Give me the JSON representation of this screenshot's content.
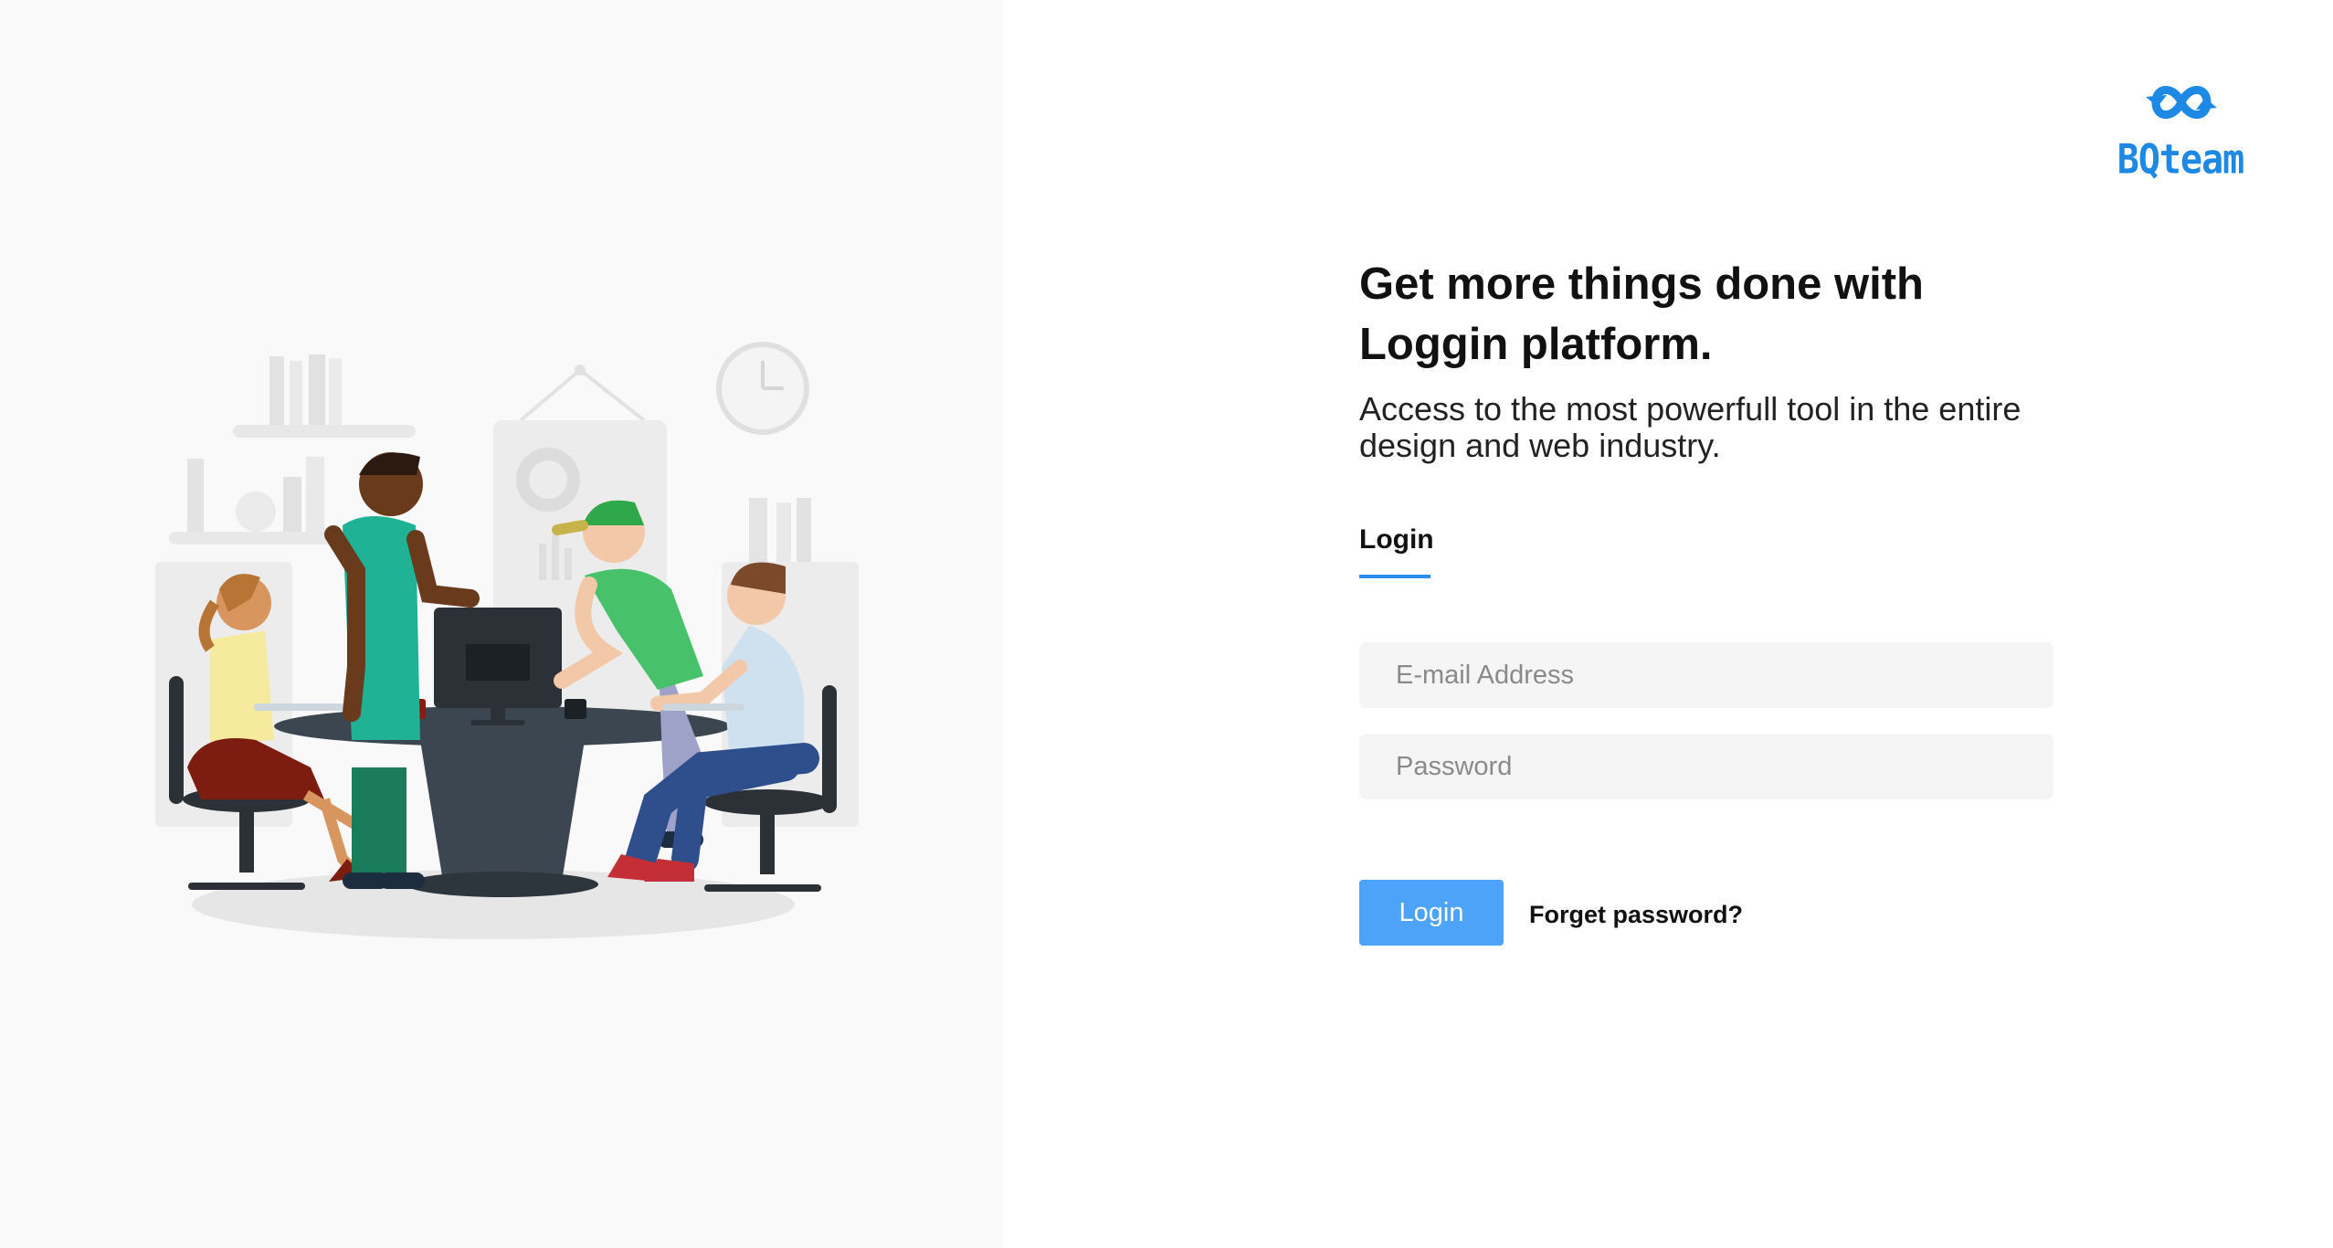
{
  "brand": {
    "name": "BQteam",
    "color": "#1e88e5",
    "mark_icon": "infinity-arrows-icon"
  },
  "hero": {
    "headline": "Get more things done with Loggin platform.",
    "subtitle": "Access to the most powerfull tool in the entire design and web industry.",
    "illustration": "team-collaboration-illustration"
  },
  "tabs": {
    "login": "Login"
  },
  "form": {
    "email_placeholder": "E-mail Address",
    "password_placeholder": "Password",
    "email_value": "",
    "password_value": "",
    "login_button": "Login",
    "forget_link": "Forget password?"
  },
  "colors": {
    "accent": "#4da3f7",
    "tab_underline": "#2d8cf0",
    "left_panel_bg": "#f9f9f9",
    "input_bg": "#f5f5f5"
  }
}
